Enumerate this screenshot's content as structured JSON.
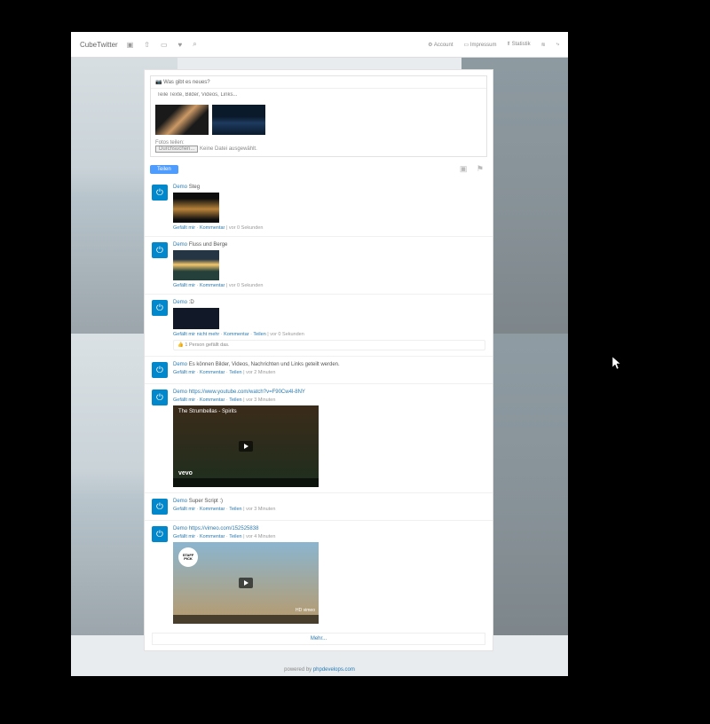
{
  "nav": {
    "brand": "CubeTwitter",
    "account": "Account",
    "impressum": "Impressum",
    "statistik": "Statistik"
  },
  "compose": {
    "header": "Was gibt es neues?",
    "placeholder": "Teile Texte, Bilder, Videos, Links...",
    "file_label": "Fotos teilen:",
    "browse_btn": "Durchsuchen...",
    "no_file": "Keine Datei ausgewählt.",
    "share_btn": "Teilen"
  },
  "labels": {
    "like": "Gefällt mir",
    "unlike": "Gefällt mir nicht mehr",
    "comment": "Kommentar",
    "share": "Teilen",
    "autoload": "Mehr..."
  },
  "posts": {
    "p0": {
      "author": "Demo",
      "text": "Steg",
      "time": "vor 0 Sekunden"
    },
    "p1": {
      "author": "Demo",
      "text": "Fluss und Berge",
      "time": "vor 0 Sekunden"
    },
    "p2": {
      "author": "Demo",
      "text": ":D",
      "time": "vor 0 Sekunden",
      "likes": "1 Person gefällt das."
    },
    "p3": {
      "author": "Demo",
      "text": "Es können Bilder, Videos, Nachrichten und Links geteilt werden.",
      "time": "vor 2 Minuten"
    },
    "p4": {
      "author": "Demo",
      "text": "https://www.youtube.com/watch?v=F90Cw4l-8NY",
      "time": "vor 3 Minuten",
      "vtitle": "The Strumbellas - Spirits",
      "vevo": "vevo"
    },
    "p5": {
      "author": "Demo",
      "text": "Super Script :)",
      "time": "vor 3 Minuten"
    },
    "p6": {
      "author": "Demo",
      "text": "https://vimeo.com/152525838",
      "time": "vor 4 Minuten",
      "badge": "STAFF PICK",
      "tag": "HD vimeo"
    }
  },
  "footer": {
    "pre": "powered by ",
    "link": "phpdevelops.com"
  }
}
